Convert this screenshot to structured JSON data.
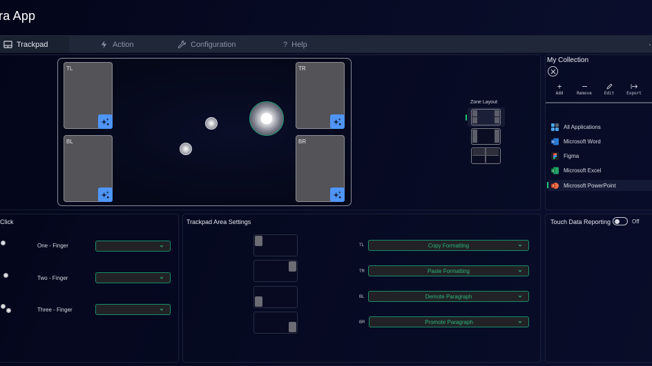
{
  "app": {
    "title": "ra App"
  },
  "nav": {
    "tabs": [
      {
        "label": "Trackpad",
        "icon": "trackpad-icon",
        "active": true
      },
      {
        "label": "Action",
        "icon": "lightning-icon",
        "active": false
      },
      {
        "label": "Configuration",
        "icon": "wrench-icon",
        "active": false
      },
      {
        "label": "Help",
        "icon": "question-icon",
        "active": false
      }
    ]
  },
  "trackpad": {
    "zones": [
      {
        "label": "TL",
        "action_icon": "sparkle-icon"
      },
      {
        "label": "TR",
        "action_icon": "sparkle-icon"
      },
      {
        "label": "BL",
        "action_icon": "sparkle-icon"
      },
      {
        "label": "BR",
        "action_icon": "sparkle-icon"
      }
    ]
  },
  "zone_layout": {
    "title": "Zone Layout",
    "options": [
      "four-corners",
      "two-sides",
      "top-bottom-split"
    ],
    "selected_index": 0
  },
  "collection": {
    "title": "My Collection",
    "actions": [
      {
        "label": "Add",
        "icon": "plus-icon"
      },
      {
        "label": "Remove",
        "icon": "minus-icon"
      },
      {
        "label": "Edit",
        "icon": "pencil-icon"
      },
      {
        "label": "Export",
        "icon": "export-icon"
      }
    ],
    "apps": [
      {
        "label": "All Applications",
        "icon": "grid-icon"
      },
      {
        "label": "Microsoft Word",
        "icon": "word-icon"
      },
      {
        "label": "Figma",
        "icon": "figma-icon"
      },
      {
        "label": "Microsoft Excel",
        "icon": "excel-icon"
      },
      {
        "label": "Microsoft PowerPoint",
        "icon": "powerpoint-icon",
        "selected": true
      }
    ]
  },
  "click_panel": {
    "title": "Click",
    "rows": [
      {
        "label": "One - Finger",
        "value": ""
      },
      {
        "label": "Two - Finger",
        "value": ""
      },
      {
        "label": "Three - Finger",
        "value": ""
      }
    ]
  },
  "area_settings": {
    "title": "Trackpad Area Settings",
    "mappings": [
      {
        "corner": "TL",
        "action": "Copy Formatting"
      },
      {
        "corner": "TR",
        "action": "Paste Formatting"
      },
      {
        "corner": "BL",
        "action": "Demote Paragraph"
      },
      {
        "corner": "BR",
        "action": "Promote Paragraph"
      }
    ]
  },
  "touch_data": {
    "label": "Touch Data Reporting",
    "state": "Off",
    "enabled": false
  },
  "colors": {
    "accent_green": "#1fcb7a",
    "dropdown_border": "#17906a",
    "zone_button": "#4f95f5",
    "navbar": "#1f2738"
  }
}
